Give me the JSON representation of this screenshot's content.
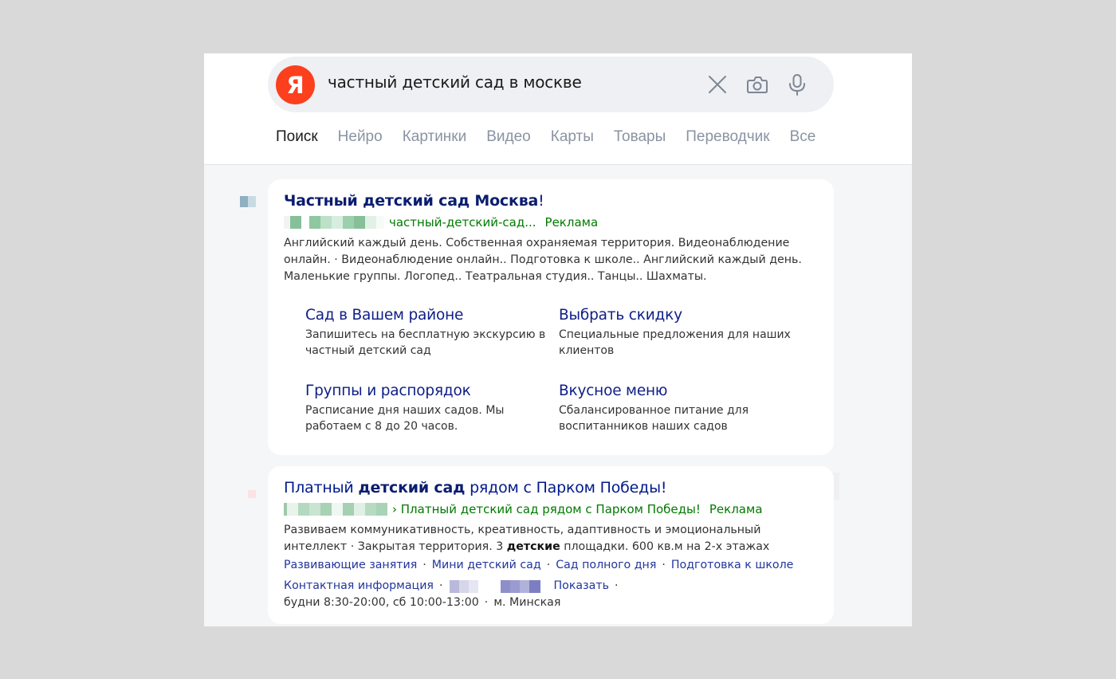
{
  "search": {
    "logo_letter": "Я",
    "query": "частный детский сад в москве"
  },
  "tabs": [
    "Поиск",
    "Нейро",
    "Картинки",
    "Видео",
    "Карты",
    "Товары",
    "Переводчик",
    "Все"
  ],
  "ad1": {
    "title_bold": "Частный детский сад Москва",
    "title_rest": "!",
    "url": "частный-детский-сад...",
    "label": "Реклама",
    "desc": "Английский каждый день. Собственная охраняемая территория. Видеонаблюдение онлайн. · Видеонаблюдение онлайн.. Подготовка к школе.. Английский каждый день. Маленькие группы. Логопед.. Театральная студия.. Танцы.. Шахматы.",
    "sitelinks": [
      {
        "title": "Сад в Вашем районе",
        "desc": "Запишитесь на бесплатную экскурсию в частный детский сад"
      },
      {
        "title": "Выбрать скидку",
        "desc": "Специальные предложения для наших клиентов"
      },
      {
        "title": "Группы и распорядок",
        "desc": "Расписание дня наших садов. Мы работаем с 8 до 20 часов."
      },
      {
        "title": "Вкусное меню",
        "desc": "Сбалансированное питание для воспитанников наших садов"
      }
    ]
  },
  "ad2": {
    "title_a": "Платный ",
    "title_bold": "детский сад",
    "title_b": " рядом с Парком Победы!",
    "url": "› Платный детский сад рядом с Парком Победы!",
    "label": "Реклама",
    "desc_a": "Развиваем коммуникативность, креативность, адаптивность и эмоциональный интеллект · Закрытая территория. 3 ",
    "desc_bold": "детские",
    "desc_b": " площадки. 600 кв.м на 2-х этажах",
    "links": [
      "Развивающие занятия",
      "Мини детский сад",
      "Сад полного дня",
      "Подготовка к школе"
    ],
    "contact": "Контактная информация",
    "show": "Показать",
    "hours": "будни 8:30-20:00, сб 10:00-13:00",
    "metro": "м. Минская",
    "sep": "·"
  },
  "colors": {
    "logo": "#fc3f1d",
    "title": "#001a8c",
    "url_green": "#007a00",
    "link": "#22359c"
  },
  "icons": [
    "clear-icon",
    "camera-icon",
    "microphone-icon"
  ]
}
